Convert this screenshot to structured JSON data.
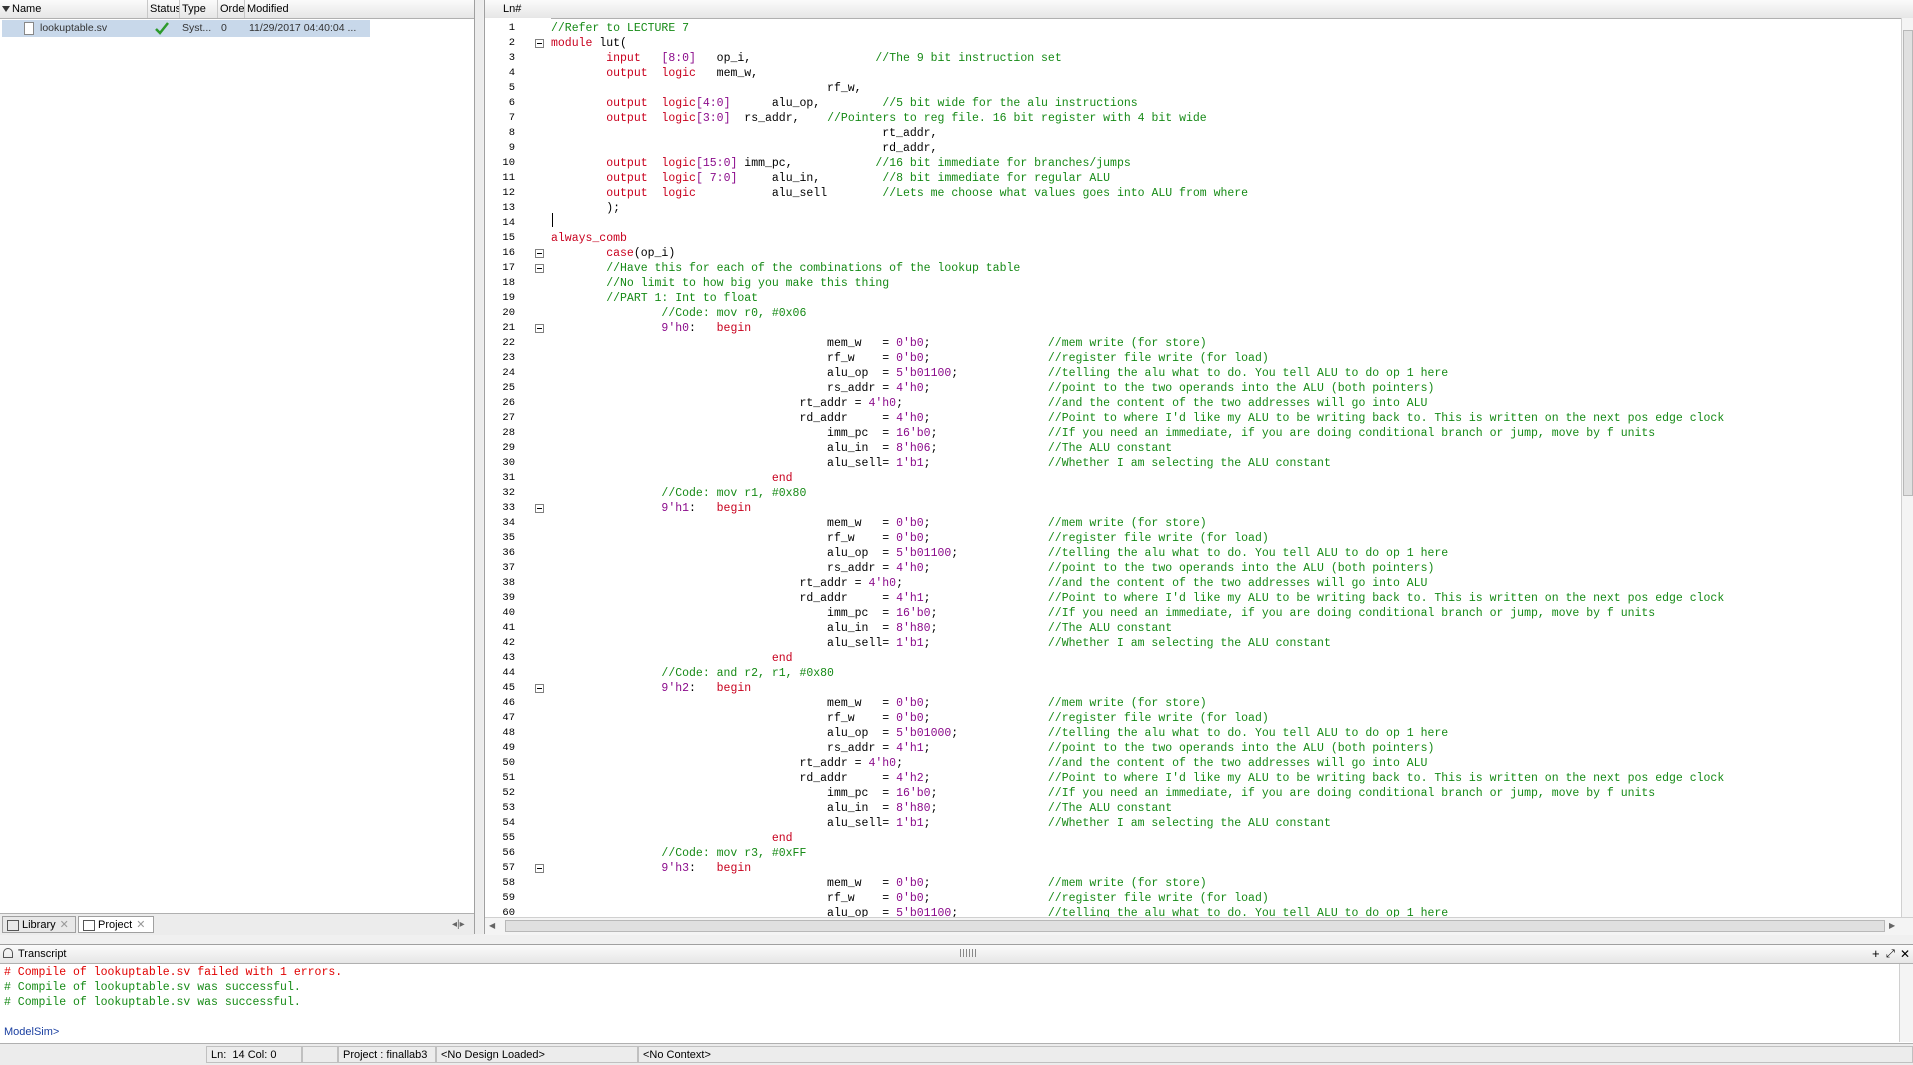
{
  "project": {
    "columns": [
      "Name",
      "Status",
      "Type",
      "Order",
      "Modified"
    ],
    "rows": [
      {
        "name": "lookuptable.sv",
        "type": "Syst...",
        "order": "0",
        "modified": "11/29/2017 04:40:04 ..."
      }
    ],
    "tabs": [
      "Library",
      "Project"
    ]
  },
  "editor": {
    "header": "Ln#",
    "lines": [
      [
        [
          "cm",
          "//Refer to LECTURE 7"
        ]
      ],
      [
        [
          "kw",
          "module"
        ],
        [
          "fn",
          " lut("
        ]
      ],
      [
        [
          "fn",
          "        "
        ],
        [
          "kw",
          "input"
        ],
        [
          "fn",
          "   "
        ],
        [
          "nm",
          "[8:0]"
        ],
        [
          "fn",
          "   op_i,                  "
        ],
        [
          "cm",
          "//The 9 bit instruction set"
        ]
      ],
      [
        [
          "fn",
          "        "
        ],
        [
          "kw",
          "output"
        ],
        [
          "fn",
          "  "
        ],
        [
          "kw",
          "logic"
        ],
        [
          "fn",
          "   mem_w,"
        ]
      ],
      [
        [
          "fn",
          "                                        rf_w,"
        ]
      ],
      [
        [
          "fn",
          "        "
        ],
        [
          "kw",
          "output"
        ],
        [
          "fn",
          "  "
        ],
        [
          "kw",
          "logic"
        ],
        [
          "nm",
          "[4:0]"
        ],
        [
          "fn",
          "      alu_op,         "
        ],
        [
          "cm",
          "//5 bit wide for the alu instructions"
        ]
      ],
      [
        [
          "fn",
          "        "
        ],
        [
          "kw",
          "output"
        ],
        [
          "fn",
          "  "
        ],
        [
          "kw",
          "logic"
        ],
        [
          "nm",
          "[3:0]"
        ],
        [
          "fn",
          "  rs_addr,    "
        ],
        [
          "cm",
          "//Pointers to reg file. 16 bit register with 4 bit wide"
        ]
      ],
      [
        [
          "fn",
          "                                                rt_addr,"
        ]
      ],
      [
        [
          "fn",
          "                                                rd_addr,"
        ]
      ],
      [
        [
          "fn",
          "        "
        ],
        [
          "kw",
          "output"
        ],
        [
          "fn",
          "  "
        ],
        [
          "kw",
          "logic"
        ],
        [
          "nm",
          "[15:0]"
        ],
        [
          "fn",
          " imm_pc,            "
        ],
        [
          "cm",
          "//16 bit immediate for branches/jumps"
        ]
      ],
      [
        [
          "fn",
          "        "
        ],
        [
          "kw",
          "output"
        ],
        [
          "fn",
          "  "
        ],
        [
          "kw",
          "logic"
        ],
        [
          "nm",
          "[ 7:0]"
        ],
        [
          "fn",
          "     alu_in,         "
        ],
        [
          "cm",
          "//8 bit immediate for regular ALU"
        ]
      ],
      [
        [
          "fn",
          "        "
        ],
        [
          "kw",
          "output"
        ],
        [
          "fn",
          "  "
        ],
        [
          "kw",
          "logic"
        ],
        [
          "fn",
          "           alu_sell        "
        ],
        [
          "cm",
          "//Lets me choose what values goes into ALU from where"
        ]
      ],
      [
        [
          "fn",
          "        );"
        ]
      ],
      [
        [
          "fn",
          ""
        ]
      ],
      [
        [
          "kw",
          "always_comb"
        ]
      ],
      [
        [
          "fn",
          "        "
        ],
        [
          "kw",
          "case"
        ],
        [
          "fn",
          "(op_i)"
        ]
      ],
      [
        [
          "fn",
          "        "
        ],
        [
          "cm",
          "//Have this for each of the combinations of the lookup table"
        ]
      ],
      [
        [
          "fn",
          "        "
        ],
        [
          "cm",
          "//No limit to how big you make this thing"
        ]
      ],
      [
        [
          "fn",
          "        "
        ],
        [
          "cm",
          "//PART 1: Int to float"
        ]
      ],
      [
        [
          "fn",
          "                "
        ],
        [
          "cm",
          "//Code: mov r0, #0x06"
        ]
      ],
      [
        [
          "fn",
          "                "
        ],
        [
          "nm",
          "9'h0"
        ],
        [
          "fn",
          ":   "
        ],
        [
          "kw",
          "begin"
        ]
      ],
      [
        [
          "fn",
          "                                        mem_w   = "
        ],
        [
          "nm",
          "0'b0"
        ],
        [
          "fn",
          ";                 "
        ],
        [
          "cm",
          "//mem write (for store)"
        ]
      ],
      [
        [
          "fn",
          "                                        rf_w    = "
        ],
        [
          "nm",
          "0'b0"
        ],
        [
          "fn",
          ";                 "
        ],
        [
          "cm",
          "//register file write (for load)"
        ]
      ],
      [
        [
          "fn",
          "                                        alu_op  = "
        ],
        [
          "nm",
          "5'b01100"
        ],
        [
          "fn",
          ";             "
        ],
        [
          "cm",
          "//telling the alu what to do. You tell ALU to do op 1 here"
        ]
      ],
      [
        [
          "fn",
          "                                        rs_addr = "
        ],
        [
          "nm",
          "4'h0"
        ],
        [
          "fn",
          ";                 "
        ],
        [
          "cm",
          "//point to the two operands into the ALU (both pointers)"
        ]
      ],
      [
        [
          "fn",
          "                                    rt_addr = "
        ],
        [
          "nm",
          "4'h0"
        ],
        [
          "fn",
          ";                     "
        ],
        [
          "cm",
          "//and the content of the two addresses will go into ALU"
        ]
      ],
      [
        [
          "fn",
          "                                    rd_addr     = "
        ],
        [
          "nm",
          "4'h0"
        ],
        [
          "fn",
          ";                 "
        ],
        [
          "cm",
          "//Point to where I'd like my ALU to be writing back to. This is written on the next pos edge clock"
        ]
      ],
      [
        [
          "fn",
          "                                        imm_pc  = "
        ],
        [
          "nm",
          "16'b0"
        ],
        [
          "fn",
          ";                "
        ],
        [
          "cm",
          "//If you need an immediate, if you are doing conditional branch or jump, move by f units"
        ]
      ],
      [
        [
          "fn",
          "                                        alu_in  = "
        ],
        [
          "nm",
          "8'h06"
        ],
        [
          "fn",
          ";                "
        ],
        [
          "cm",
          "//The ALU constant"
        ]
      ],
      [
        [
          "fn",
          "                                        alu_sell= "
        ],
        [
          "nm",
          "1'b1"
        ],
        [
          "fn",
          ";                 "
        ],
        [
          "cm",
          "//Whether I am selecting the ALU constant"
        ]
      ],
      [
        [
          "fn",
          "                                "
        ],
        [
          "kw",
          "end"
        ]
      ],
      [
        [
          "fn",
          "                "
        ],
        [
          "cm",
          "//Code: mov r1, #0x80"
        ]
      ],
      [
        [
          "fn",
          "                "
        ],
        [
          "nm",
          "9'h1"
        ],
        [
          "fn",
          ":   "
        ],
        [
          "kw",
          "begin"
        ]
      ],
      [
        [
          "fn",
          "                                        mem_w   = "
        ],
        [
          "nm",
          "0'b0"
        ],
        [
          "fn",
          ";                 "
        ],
        [
          "cm",
          "//mem write (for store)"
        ]
      ],
      [
        [
          "fn",
          "                                        rf_w    = "
        ],
        [
          "nm",
          "0'b0"
        ],
        [
          "fn",
          ";                 "
        ],
        [
          "cm",
          "//register file write (for load)"
        ]
      ],
      [
        [
          "fn",
          "                                        alu_op  = "
        ],
        [
          "nm",
          "5'b01100"
        ],
        [
          "fn",
          ";             "
        ],
        [
          "cm",
          "//telling the alu what to do. You tell ALU to do op 1 here"
        ]
      ],
      [
        [
          "fn",
          "                                        rs_addr = "
        ],
        [
          "nm",
          "4'h0"
        ],
        [
          "fn",
          ";                 "
        ],
        [
          "cm",
          "//point to the two operands into the ALU (both pointers)"
        ]
      ],
      [
        [
          "fn",
          "                                    rt_addr = "
        ],
        [
          "nm",
          "4'h0"
        ],
        [
          "fn",
          ";                     "
        ],
        [
          "cm",
          "//and the content of the two addresses will go into ALU"
        ]
      ],
      [
        [
          "fn",
          "                                    rd_addr     = "
        ],
        [
          "nm",
          "4'h1"
        ],
        [
          "fn",
          ";                 "
        ],
        [
          "cm",
          "//Point to where I'd like my ALU to be writing back to. This is written on the next pos edge clock"
        ]
      ],
      [
        [
          "fn",
          "                                        imm_pc  = "
        ],
        [
          "nm",
          "16'b0"
        ],
        [
          "fn",
          ";                "
        ],
        [
          "cm",
          "//If you need an immediate, if you are doing conditional branch or jump, move by f units"
        ]
      ],
      [
        [
          "fn",
          "                                        alu_in  = "
        ],
        [
          "nm",
          "8'h80"
        ],
        [
          "fn",
          ";                "
        ],
        [
          "cm",
          "//The ALU constant"
        ]
      ],
      [
        [
          "fn",
          "                                        alu_sell= "
        ],
        [
          "nm",
          "1'b1"
        ],
        [
          "fn",
          ";                 "
        ],
        [
          "cm",
          "//Whether I am selecting the ALU constant"
        ]
      ],
      [
        [
          "fn",
          "                                "
        ],
        [
          "kw",
          "end"
        ]
      ],
      [
        [
          "fn",
          "                "
        ],
        [
          "cm",
          "//Code: and r2, r1, #0x80"
        ]
      ],
      [
        [
          "fn",
          "                "
        ],
        [
          "nm",
          "9'h2"
        ],
        [
          "fn",
          ":   "
        ],
        [
          "kw",
          "begin"
        ]
      ],
      [
        [
          "fn",
          "                                        mem_w   = "
        ],
        [
          "nm",
          "0'b0"
        ],
        [
          "fn",
          ";                 "
        ],
        [
          "cm",
          "//mem write (for store)"
        ]
      ],
      [
        [
          "fn",
          "                                        rf_w    = "
        ],
        [
          "nm",
          "0'b0"
        ],
        [
          "fn",
          ";                 "
        ],
        [
          "cm",
          "//register file write (for load)"
        ]
      ],
      [
        [
          "fn",
          "                                        alu_op  = "
        ],
        [
          "nm",
          "5'b01000"
        ],
        [
          "fn",
          ";             "
        ],
        [
          "cm",
          "//telling the alu what to do. You tell ALU to do op 1 here"
        ]
      ],
      [
        [
          "fn",
          "                                        rs_addr = "
        ],
        [
          "nm",
          "4'h1"
        ],
        [
          "fn",
          ";                 "
        ],
        [
          "cm",
          "//point to the two operands into the ALU (both pointers)"
        ]
      ],
      [
        [
          "fn",
          "                                    rt_addr = "
        ],
        [
          "nm",
          "4'h0"
        ],
        [
          "fn",
          ";                     "
        ],
        [
          "cm",
          "//and the content of the two addresses will go into ALU"
        ]
      ],
      [
        [
          "fn",
          "                                    rd_addr     = "
        ],
        [
          "nm",
          "4'h2"
        ],
        [
          "fn",
          ";                 "
        ],
        [
          "cm",
          "//Point to where I'd like my ALU to be writing back to. This is written on the next pos edge clock"
        ]
      ],
      [
        [
          "fn",
          "                                        imm_pc  = "
        ],
        [
          "nm",
          "16'b0"
        ],
        [
          "fn",
          ";                "
        ],
        [
          "cm",
          "//If you need an immediate, if you are doing conditional branch or jump, move by f units"
        ]
      ],
      [
        [
          "fn",
          "                                        alu_in  = "
        ],
        [
          "nm",
          "8'h80"
        ],
        [
          "fn",
          ";                "
        ],
        [
          "cm",
          "//The ALU constant"
        ]
      ],
      [
        [
          "fn",
          "                                        alu_sell= "
        ],
        [
          "nm",
          "1'b1"
        ],
        [
          "fn",
          ";                 "
        ],
        [
          "cm",
          "//Whether I am selecting the ALU constant"
        ]
      ],
      [
        [
          "fn",
          "                                "
        ],
        [
          "kw",
          "end"
        ]
      ],
      [
        [
          "fn",
          "                "
        ],
        [
          "cm",
          "//Code: mov r3, #0xFF"
        ]
      ],
      [
        [
          "fn",
          "                "
        ],
        [
          "nm",
          "9'h3"
        ],
        [
          "fn",
          ":   "
        ],
        [
          "kw",
          "begin"
        ]
      ],
      [
        [
          "fn",
          "                                        mem_w   = "
        ],
        [
          "nm",
          "0'b0"
        ],
        [
          "fn",
          ";                 "
        ],
        [
          "cm",
          "//mem write (for store)"
        ]
      ],
      [
        [
          "fn",
          "                                        rf_w    = "
        ],
        [
          "nm",
          "0'b0"
        ],
        [
          "fn",
          ";                 "
        ],
        [
          "cm",
          "//register file write (for load)"
        ]
      ],
      [
        [
          "fn",
          "                                        alu_op  = "
        ],
        [
          "nm",
          "5'b01100"
        ],
        [
          "fn",
          ";             "
        ],
        [
          "cm",
          "//telling the alu what to do. You tell ALU to do op 1 here"
        ]
      ]
    ],
    "fold_lines": [
      2,
      16,
      17,
      21,
      33,
      45,
      57
    ]
  },
  "transcript": {
    "title": "Transcript",
    "lines": [
      {
        "text": "# Compile of lookuptable.sv failed with 1 errors.",
        "color": "#e00000"
      },
      {
        "text": "# Compile of lookuptable.sv was successful.",
        "color": "#168a16"
      },
      {
        "text": "# Compile of lookuptable.sv was successful.",
        "color": "#168a16"
      }
    ],
    "prompt": "ModelSim>"
  },
  "status": {
    "ln_label": "Ln:",
    "ln_value": "14",
    "col_label": "Col:",
    "col_value": "0",
    "project": "Project : finallab3",
    "design": "<No Design Loaded>",
    "context": "<No Context>"
  },
  "colors": {
    "keyword": "#c8001e",
    "number": "#8b0a8b",
    "comment": "#168a16",
    "error": "#e00000",
    "selection": "#c8d8ea"
  }
}
